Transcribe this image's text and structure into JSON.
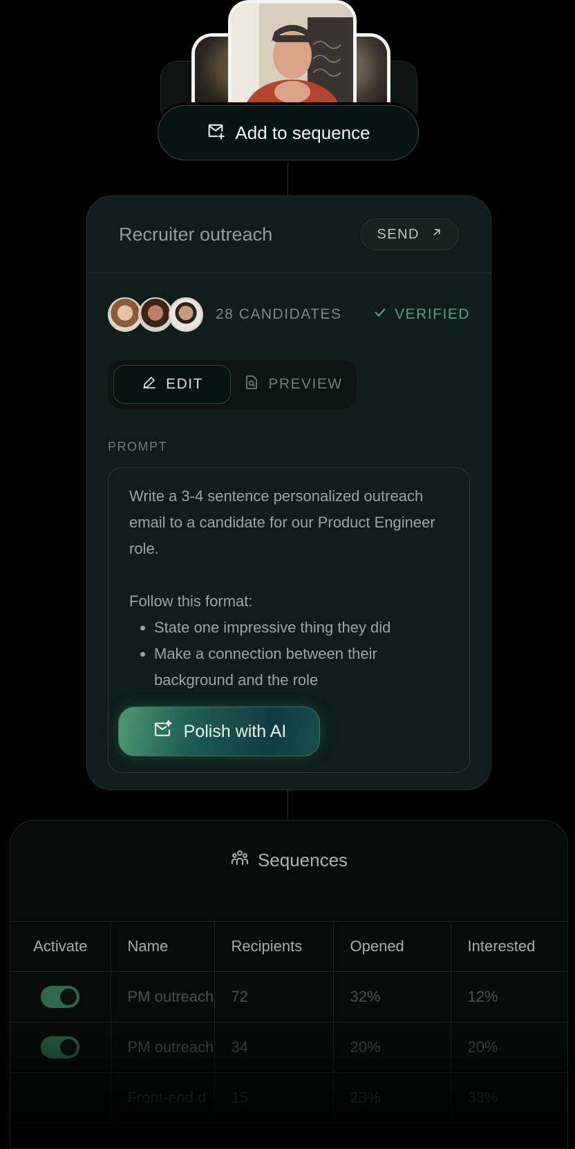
{
  "add_pill": {
    "label": "Add to sequence"
  },
  "card": {
    "title": "Recruiter outreach",
    "send_label": "SEND",
    "candidates": "28 CANDIDATES",
    "verified": "VERIFIED",
    "tabs": [
      {
        "label": "EDIT",
        "active": true
      },
      {
        "label": "PREVIEW",
        "active": false
      }
    ],
    "prompt_label": "PROMPT",
    "prompt": {
      "intro": "Write a 3-4 sentence personalized outreach email to a candidate for our Product Engineer role.",
      "format_heading": "Follow this format:",
      "bullets": [
        "State one impressive thing they did",
        "Make a connection between their background and the role"
      ]
    },
    "polish_label": "Polish with AI"
  },
  "sequences": {
    "title": "Sequences",
    "columns": [
      "Activate",
      "Name",
      "Recipients",
      "Opened",
      "Interested"
    ],
    "rows": [
      {
        "active": true,
        "name": "PM outreach",
        "recipients": "72",
        "opened": "32%",
        "interested": "12%"
      },
      {
        "active": true,
        "name": "PM outreach",
        "recipients": "34",
        "opened": "20%",
        "interested": "20%"
      },
      {
        "active": false,
        "name": "Front-end d",
        "recipients": "15",
        "opened": "23%",
        "interested": "33%"
      }
    ]
  },
  "colors": {
    "accent": "#4fa47e",
    "background": "#000000",
    "card": "#0f1e1a"
  }
}
